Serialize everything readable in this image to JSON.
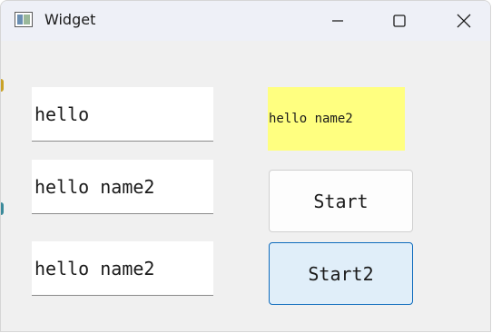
{
  "window": {
    "title": "Widget",
    "icon": "qt-widget-app-icon",
    "controls": [
      "minimize-icon",
      "maximize-icon",
      "close-icon"
    ]
  },
  "inputs": [
    {
      "value": "hello"
    },
    {
      "value": "hello name2"
    },
    {
      "value": "hello name2"
    }
  ],
  "label": {
    "text": "hello name2",
    "background": "#ffff80"
  },
  "buttons": {
    "start_label": "Start",
    "start2_label": "Start2"
  },
  "colors": {
    "focus_accent": "#0f6cbd",
    "focus_fill": "#e0eef9",
    "window_bg": "#f0f0f0"
  }
}
